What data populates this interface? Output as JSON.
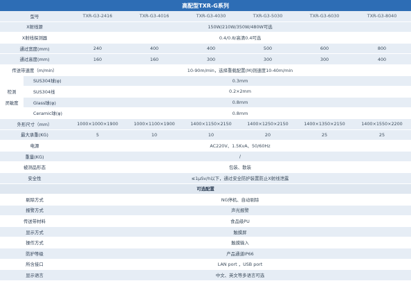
{
  "title": "高配型TXR-G系列",
  "header": {
    "label": "型号",
    "models": [
      "TXR-G3-2416",
      "TXR-G3-4016",
      "TXR-G3-4030",
      "TXR-G3-5030",
      "TXR-G3-6030",
      "TXR-G3-8040"
    ]
  },
  "rows": {
    "xray_source": {
      "label": "X射线源",
      "value": "150W/210W/350W/480W可选"
    },
    "xray_detector": {
      "label": "X射线探测器",
      "value": "0.4/0.8/高清0.4可选"
    },
    "pass_width": {
      "label": "通过宽度(mm)",
      "values": [
        "240",
        "400",
        "400",
        "500",
        "600",
        "800"
      ]
    },
    "pass_height": {
      "label": "通过高度(mm)",
      "values": [
        "160",
        "160",
        "300",
        "300",
        "300",
        "400"
      ]
    },
    "belt_speed": {
      "label": "传送带速度（m/min）",
      "value": "10-90m/min，选择重载配置(M)则速度10-40m/min"
    },
    "sensitivity": {
      "group_label_1": "检测",
      "group_label_2": "灵敏度",
      "items": [
        {
          "label": "SUS304球(φ)",
          "value": "0.3mm"
        },
        {
          "label": "SUS304线",
          "value": "0.2×2mm"
        },
        {
          "label": "Glass球(φ)",
          "value": "0.8mm"
        },
        {
          "label": "Ceramic球(φ)",
          "value": "0.8mm"
        }
      ]
    },
    "dimensions": {
      "label": "外形尺寸（mm）",
      "values": [
        "1000×1000×1900",
        "1000×1100×1900",
        "1400×1150×2150",
        "1400×1250×2150",
        "1400×1350×2150",
        "1400×1550×2200"
      ]
    },
    "max_load": {
      "label": "最大承重(KG)",
      "values": [
        "5",
        "10",
        "10",
        "20",
        "25",
        "25"
      ]
    },
    "power": {
      "label": "电源",
      "value": "AC220V、1.5KvA、50/60Hz"
    },
    "weight": {
      "label": "重量(KG)",
      "value": "/"
    },
    "product_form": {
      "label": "被测品形态",
      "value": "包装、散装"
    },
    "safety": {
      "label": "安全性",
      "value": "≤1μSv/h以下，通过安全防护装置防止X射线泄露"
    }
  },
  "optional": {
    "section_title": "可选配置",
    "items": [
      {
        "label": "剔除方式",
        "value": "NG停机、自动剔除"
      },
      {
        "label": "报警方式",
        "value": "声光报警"
      },
      {
        "label": "传送带材料",
        "value": "食品级PU"
      },
      {
        "label": "显示方式",
        "value": "触摸屏"
      },
      {
        "label": "操作方式",
        "value": "触摸输入"
      },
      {
        "label": "防护等级",
        "value": "产品通道IP66"
      },
      {
        "label": "所含接口",
        "value": "LAN port ，USB port"
      },
      {
        "label": "显示语言",
        "value": "中文、英文等多语言可选"
      }
    ]
  },
  "colors": {
    "title_bg": "#2d6db5",
    "row_shade": "#e6edf5",
    "text": "#3a4a5a"
  }
}
